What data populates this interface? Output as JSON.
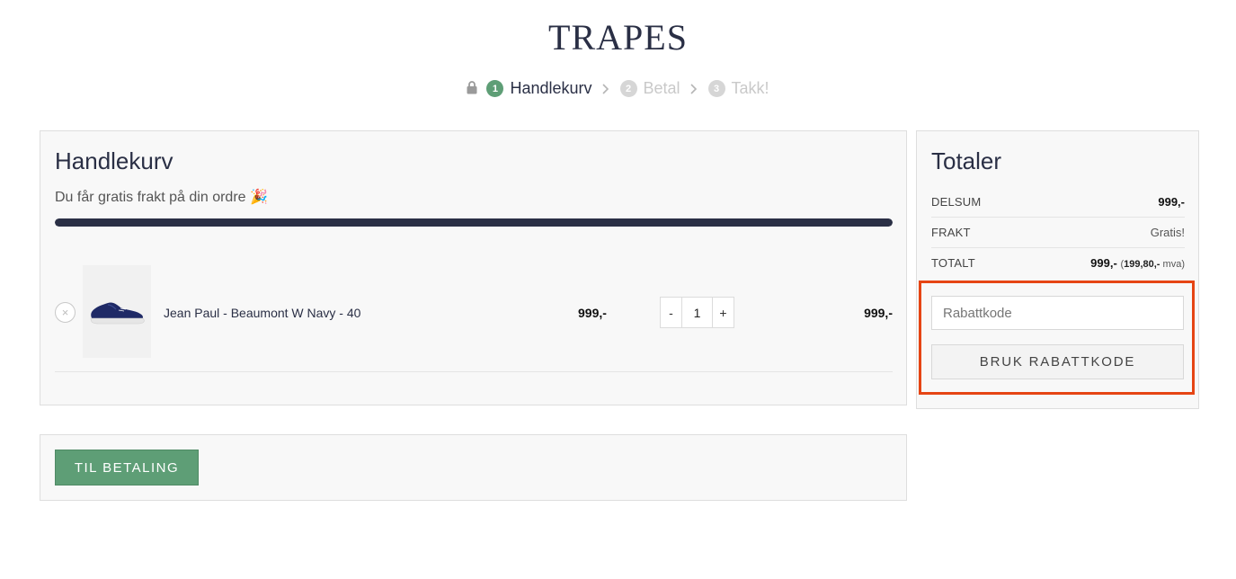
{
  "brand": {
    "logo_text": "TRAPES"
  },
  "steps": [
    {
      "number": "1",
      "label": "Handlekurv",
      "state": "active"
    },
    {
      "number": "2",
      "label": "Betal",
      "state": "inactive"
    },
    {
      "number": "3",
      "label": "Takk!",
      "state": "inactive"
    }
  ],
  "cart": {
    "title": "Handlekurv",
    "free_shipping_message": "Du får gratis frakt på din ordre 🎉",
    "free_shipping_progress": 1.0,
    "items": [
      {
        "name": "Jean Paul - Beaumont W Navy - 40",
        "price": "999,-",
        "qty_minus": "-",
        "quantity": "1",
        "qty_plus": "+",
        "line_total": "999,-",
        "remove_glyph": "×"
      }
    ]
  },
  "totals": {
    "title": "Totaler",
    "rows": [
      {
        "label": "DELSUM",
        "value": "999,-"
      },
      {
        "label": "FRAKT",
        "value": "Gratis!"
      },
      {
        "label": "TOTALT",
        "value": "999,-",
        "vat_open": "(",
        "vat_amount": "199,80,-",
        "vat_label": "mva)"
      }
    ],
    "coupon": {
      "placeholder": "Rabattkode",
      "button_label": "BRUK RABATTKODE"
    }
  },
  "checkout": {
    "button_label": "TIL BETALING"
  },
  "colors": {
    "accent_green": "#5e9e76",
    "navy": "#2a2f45",
    "highlight_orange": "#e64514"
  },
  "icons": {
    "lock": "lock-icon",
    "chevron": "chevron-right-icon",
    "remove": "remove-icon"
  }
}
